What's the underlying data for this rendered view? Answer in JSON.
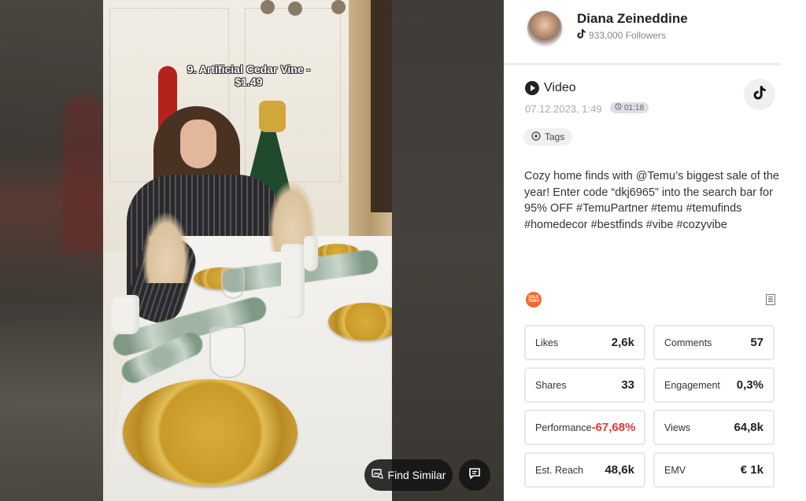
{
  "video_overlay": {
    "caption_line1": "9. Artificial Cedar Vine -",
    "caption_line2": "$1.49",
    "find_similar_label": "Find Similar",
    "find_similar_icon": "image-search-icon",
    "comment_icon": "comment-icon"
  },
  "profile": {
    "name": "Diana Zeineddine",
    "followers": "933,000 Followers",
    "platform_icon": "tiktok-icon"
  },
  "post": {
    "type_label": "Video",
    "date": "07.12.2023, 1:49",
    "duration": "01:18",
    "tags_label": "Tags",
    "description": "Cozy home finds with @Temu’s biggest sale of the year! Enter code “dkj6965” into the search bar for 95% OFF #TemuPartner #temu #temufinds #homedecor #bestfinds #vibe #cozyvibe",
    "brand_logo_text": "SALE TEMU"
  },
  "stats": [
    {
      "label": "Likes",
      "value": "2,6k"
    },
    {
      "label": "Comments",
      "value": "57"
    },
    {
      "label": "Shares",
      "value": "33"
    },
    {
      "label": "Engagement",
      "value": "0,3%"
    },
    {
      "label": "Performance",
      "value": "-67,68%"
    },
    {
      "label": "Views",
      "value": "64,8k"
    },
    {
      "label": "Est. Reach",
      "value": "48,6k"
    },
    {
      "label": "EMV",
      "value": "€ 1k"
    }
  ],
  "colors": {
    "negative": "#e53935",
    "brand": "#f26a2c"
  }
}
